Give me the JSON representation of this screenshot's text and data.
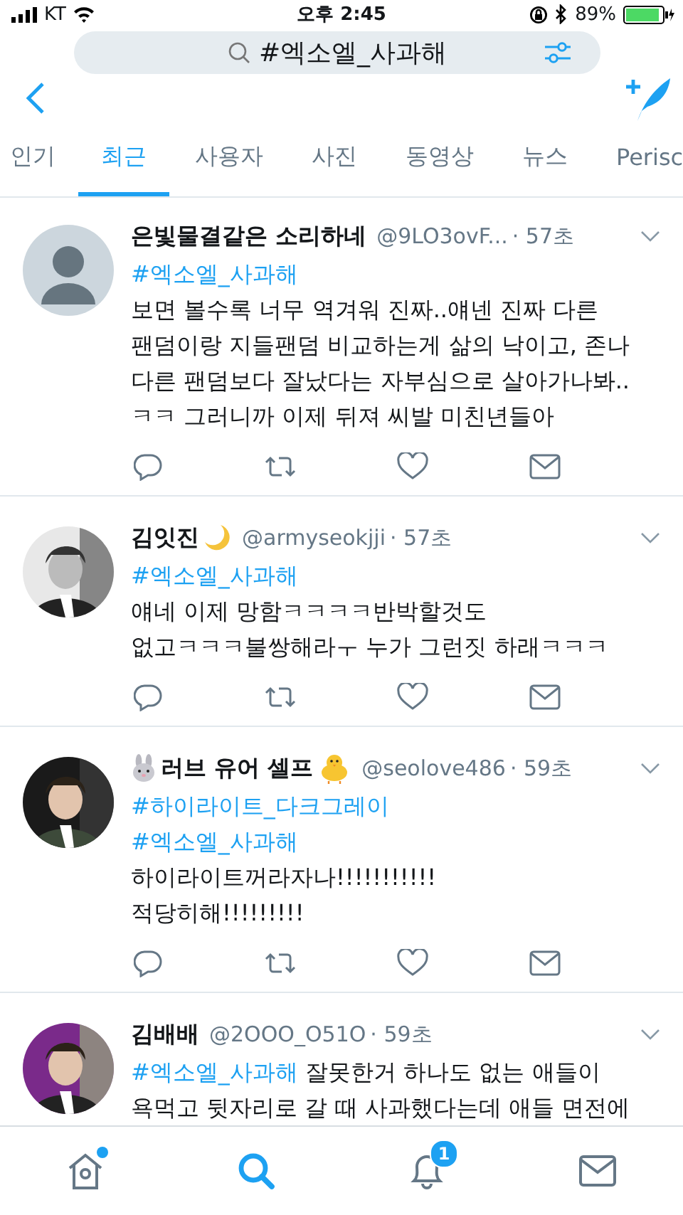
{
  "status_bar": {
    "carrier": "KT",
    "time": "오후 2:45",
    "battery": "89%"
  },
  "search": {
    "value": "#엑소엘_사과해"
  },
  "tabs": [
    {
      "label": "인기",
      "selected": false
    },
    {
      "label": "최근",
      "selected": true
    },
    {
      "label": "사용자",
      "selected": false
    },
    {
      "label": "사진",
      "selected": false
    },
    {
      "label": "동영상",
      "selected": false
    },
    {
      "label": "뉴스",
      "selected": false
    },
    {
      "label": "Perisc",
      "selected": false
    }
  ],
  "tweets": [
    {
      "avatar": {
        "kind": "default"
      },
      "name": "은빛물결같은 소리하네",
      "handle": "@9LO3ovF...",
      "time": "· 57초",
      "lines": [
        [
          {
            "kind": "hashtag",
            "text": "#엑소엘_사과해"
          }
        ],
        [
          {
            "kind": "text",
            "text": "보면 볼수록 너무 역겨워 진짜..얘넨 진짜 다른"
          }
        ],
        [
          {
            "kind": "text",
            "text": "팬덤이랑 지들팬덤 비교하는게 삶의 낙이고, 존나"
          }
        ],
        [
          {
            "kind": "text",
            "text": "다른 팬덤보다 잘났다는 자부심으로 살아가나봐.."
          }
        ],
        [
          {
            "kind": "text",
            "text": "ㅋㅋ 그러니까 이제 뒤져 씨발 미친년들아"
          }
        ]
      ]
    },
    {
      "avatar": {
        "kind": "picture"
      },
      "name": "김잇진",
      "icons_after": [
        {
          "kind": "moon"
        }
      ],
      "handle": "@armyseokjji",
      "time": "· 57초",
      "lines": [
        [
          {
            "kind": "hashtag",
            "text": "#엑소엘_사과해"
          }
        ],
        [
          {
            "kind": "text",
            "text": "얘네 이제 망함ㅋㅋㅋㅋ반박할것도"
          }
        ],
        [
          {
            "kind": "text",
            "text": "없고ㅋㅋㅋ불쌍해라ㅜ 누가 그런짓 하래ㅋㅋㅋ"
          }
        ]
      ]
    },
    {
      "avatar": {
        "kind": "picture"
      },
      "name": "러브 유어 셀프",
      "icons_before": [
        {
          "kind": "rabbit"
        }
      ],
      "icons_after": [
        {
          "kind": "chick"
        }
      ],
      "handle": "@seolove486",
      "time": "· 59초",
      "lines": [
        [
          {
            "kind": "hashtag",
            "text": "#하이라이트_다크그레이"
          }
        ],
        [
          {
            "kind": "hashtag",
            "text": "#엑소엘_사과해"
          }
        ],
        [
          {
            "kind": "text",
            "text": "하이라이트꺼라자나!!!!!!!!!!!"
          }
        ],
        [
          {
            "kind": "text",
            "text": "적당히해!!!!!!!!!"
          }
        ]
      ]
    },
    {
      "avatar": {
        "kind": "picture"
      },
      "name": "김배배",
      "handle": "@2OOO_O51O",
      "time": "· 59초",
      "lines": [
        [
          {
            "kind": "hashtag",
            "text": "#엑소엘_사과해"
          },
          {
            "kind": "text",
            "text": " 잘못한거 하나도 없는 애들이"
          }
        ],
        [
          {
            "kind": "text",
            "text": "욕먹고 뒷자리로 갈 때 사과했다는데 애들 면전에"
          }
        ]
      ]
    }
  ],
  "bottom_nav": [
    {
      "kind": "home",
      "selected": false,
      "dot": true
    },
    {
      "kind": "search",
      "selected": true,
      "dot": false
    },
    {
      "kind": "bell",
      "selected": false,
      "dot": false,
      "badge": "1"
    },
    {
      "kind": "mail",
      "selected": false,
      "dot": false
    }
  ]
}
